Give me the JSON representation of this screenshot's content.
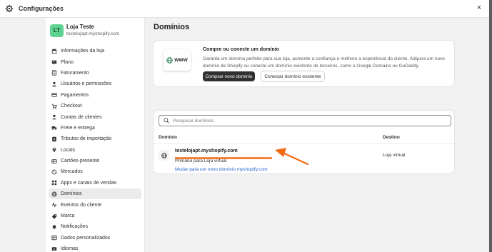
{
  "window": {
    "title": "Configurações",
    "close_label": "×"
  },
  "store": {
    "initials": "LT",
    "name": "Loja Teste",
    "url": "testelojapt.myshopify.com"
  },
  "sidebar": {
    "items": [
      {
        "label": "Informações da loja",
        "icon": "store-icon"
      },
      {
        "label": "Plano",
        "icon": "plan-icon"
      },
      {
        "label": "Faturamento",
        "icon": "billing-icon"
      },
      {
        "label": "Usuários e permissões",
        "icon": "users-icon"
      },
      {
        "label": "Pagamentos",
        "icon": "payments-icon"
      },
      {
        "label": "Checkout",
        "icon": "cart-icon"
      },
      {
        "label": "Contas de clientes",
        "icon": "person-icon"
      },
      {
        "label": "Frete e entrega",
        "icon": "truck-icon"
      },
      {
        "label": "Tributos de importação",
        "icon": "duties-icon"
      },
      {
        "label": "Locais",
        "icon": "location-icon"
      },
      {
        "label": "Cartões-presente",
        "icon": "gift-card-icon"
      },
      {
        "label": "Mercados",
        "icon": "markets-icon"
      },
      {
        "label": "Apps e canais de vendas",
        "icon": "apps-icon"
      },
      {
        "label": "Domínios",
        "icon": "globe-icon",
        "active": true
      },
      {
        "label": "Eventos do cliente",
        "icon": "events-icon"
      },
      {
        "label": "Marca",
        "icon": "brand-icon"
      },
      {
        "label": "Notificações",
        "icon": "bell-icon"
      },
      {
        "label": "Dados personalizados",
        "icon": "data-icon"
      },
      {
        "label": "Idiomas",
        "icon": "language-icon"
      }
    ]
  },
  "main": {
    "title": "Domínios",
    "promo": {
      "illustration": "WWW",
      "title": "Compre ou conecte um domínio",
      "description": "Garanta um domínio perfeito para sua loja, aumente a confiança e melhore a experiência do cliente. Adquira um novo domínio da Shopify ou conecte um domínio existente de terceiros, como o Google Domains ou GoDaddy.",
      "buy_button": "Comprar novo domínio",
      "connect_button": "Conectar domínio existente"
    },
    "domains": {
      "search_placeholder": "Pesquisar domínios",
      "columns": {
        "domain": "Domínio",
        "destination": "Destino"
      },
      "rows": [
        {
          "name": "testelojapt.myshopify.com",
          "subtitle": "Primário para Loja virtual",
          "link": "Mudar para um novo domínio myshopify.com",
          "destination": "Loja virtual"
        }
      ]
    }
  },
  "colors": {
    "accent_link": "#2463d0",
    "annotation": "#f26a14",
    "avatar": "#60d28f"
  }
}
